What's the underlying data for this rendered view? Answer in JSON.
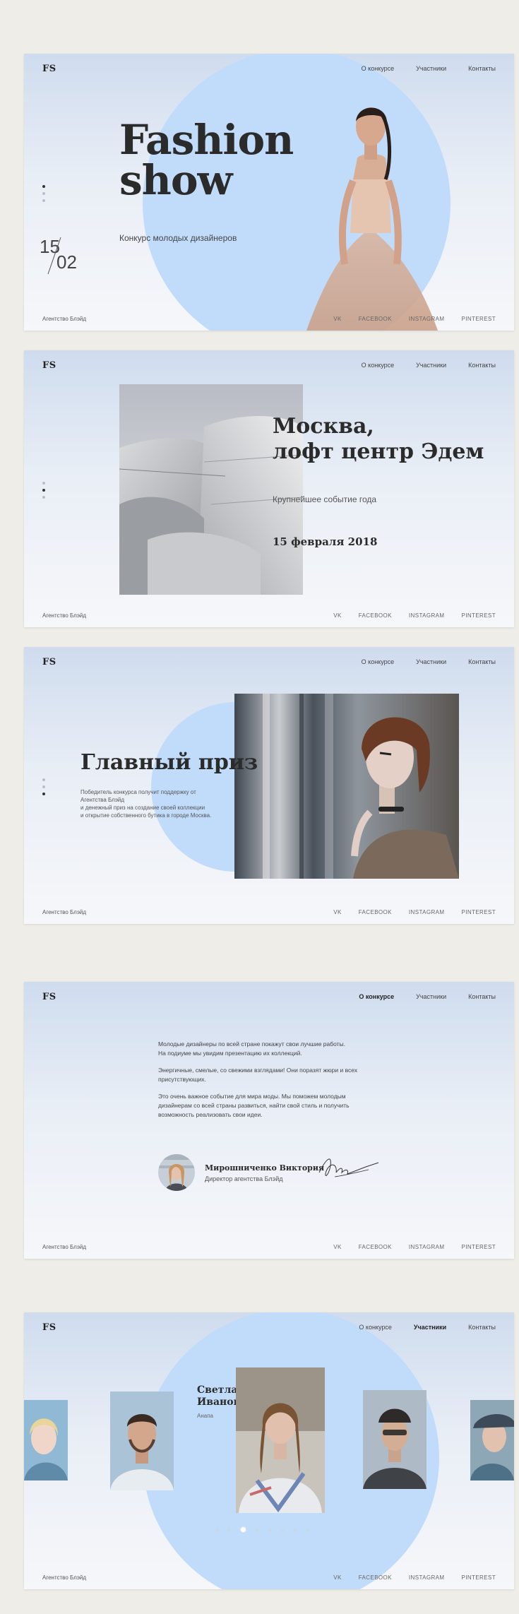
{
  "brand": {
    "logo": "FS"
  },
  "colors": {
    "accent_circle": "#c0dcfa",
    "background": "#efede8",
    "text_dark": "#2b2b2b"
  },
  "nav": [
    "О конкурсе",
    "Участники",
    "Контакты"
  ],
  "footer": {
    "agency": "Агентство Блэйд",
    "social": [
      "VK",
      "FACEBOOK",
      "INSTAGRAM",
      "PINTEREST"
    ]
  },
  "slide1": {
    "title_line1": "Fashion",
    "title_line2": "show",
    "subtitle": "Конкурс молодых дизайнеров",
    "date_day": "15",
    "date_month": "02"
  },
  "slide2": {
    "city_line1": "Москва,",
    "city_line2": "лофт центр Эдем",
    "tagline": "Крупнейшее событие года",
    "date": "15 февраля 2018"
  },
  "slide3": {
    "title": "Главный приз",
    "text_line1": "Победитель конкурса получит поддержку от",
    "text_line2": "Агентства Блэйд",
    "text_line3": "и денежный приз на создание своей коллекции",
    "text_line4": "и открытие собственного бутика в городе Москва."
  },
  "slide4": {
    "p1_line1": "Молодые дизайнеры по всей стране покажут свои лучшие работы.",
    "p1_line2": "На подиуме мы увидим презентацию их коллекций.",
    "p2_line1": "Энергичные, смелые, со свежими взглядами! Они поразят жюри и всех",
    "p2_line2": "присутствующих.",
    "p3_line1": "Это очень важное событие для мира моды. Мы поможем молодым",
    "p3_line2": "дизайнерам со всей страны развиться, найти свой стиль и получить",
    "p3_line3": "возможность реализовать свои идеи.",
    "author_name": "Мирошниченко Виктория",
    "author_role": "Директор агентства Блэйд"
  },
  "slide5": {
    "name_line1": "Светлана",
    "name_line2": "Иванова",
    "city": "Анапа"
  }
}
